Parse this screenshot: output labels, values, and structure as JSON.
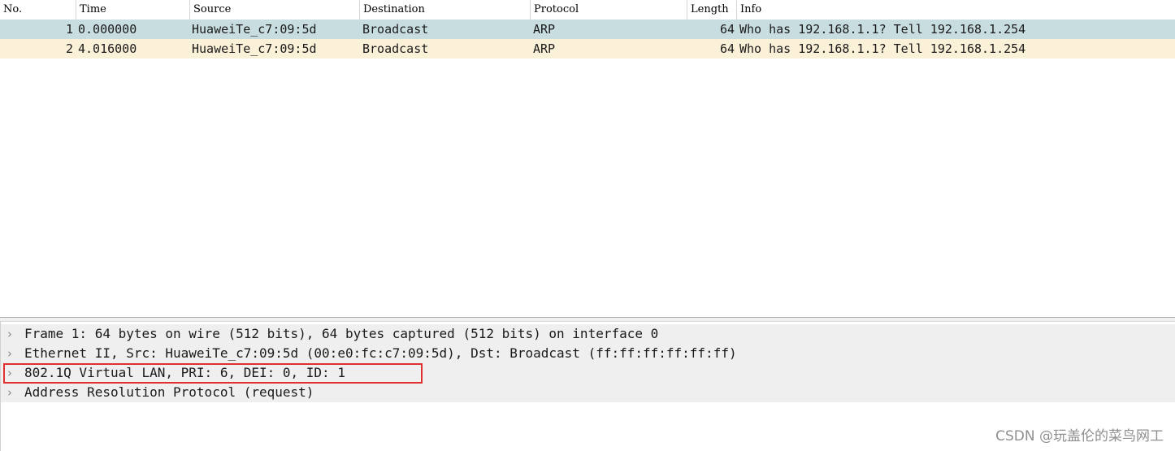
{
  "packet_list": {
    "columns": [
      "No.",
      "Time",
      "Source",
      "Destination",
      "Protocol",
      "Length",
      "Info"
    ],
    "rows": [
      {
        "no": "1",
        "time": "0.000000",
        "source": "HuaweiTe_c7:09:5d",
        "destination": "Broadcast",
        "protocol": "ARP",
        "length": "64",
        "info": "Who has 192.168.1.1? Tell 192.168.1.254",
        "selected": true
      },
      {
        "no": "2",
        "time": "4.016000",
        "source": "HuaweiTe_c7:09:5d",
        "destination": "Broadcast",
        "protocol": "ARP",
        "length": "64",
        "info": "Who has 192.168.1.1? Tell 192.168.1.254",
        "selected": false
      }
    ]
  },
  "details": {
    "items": [
      {
        "label": "Frame 1: 64 bytes on wire (512 bits), 64 bytes captured (512 bits) on interface 0",
        "icon": "chevron-right-icon"
      },
      {
        "label": "Ethernet II, Src: HuaweiTe_c7:09:5d (00:e0:fc:c7:09:5d), Dst: Broadcast (ff:ff:ff:ff:ff:ff)",
        "icon": "chevron-right-icon"
      },
      {
        "label": "802.1Q Virtual LAN, PRI: 6, DEI: 0, ID: 1",
        "icon": "chevron-right-icon",
        "highlighted": true
      },
      {
        "label": "Address Resolution Protocol (request)",
        "icon": "chevron-right-icon"
      }
    ]
  },
  "watermark": "CSDN @玩盖伦的菜鸟网工",
  "colors": {
    "selected_row": "#c8dde0",
    "alt_row": "#fbf0d8",
    "highlight_box": "#e03030"
  }
}
